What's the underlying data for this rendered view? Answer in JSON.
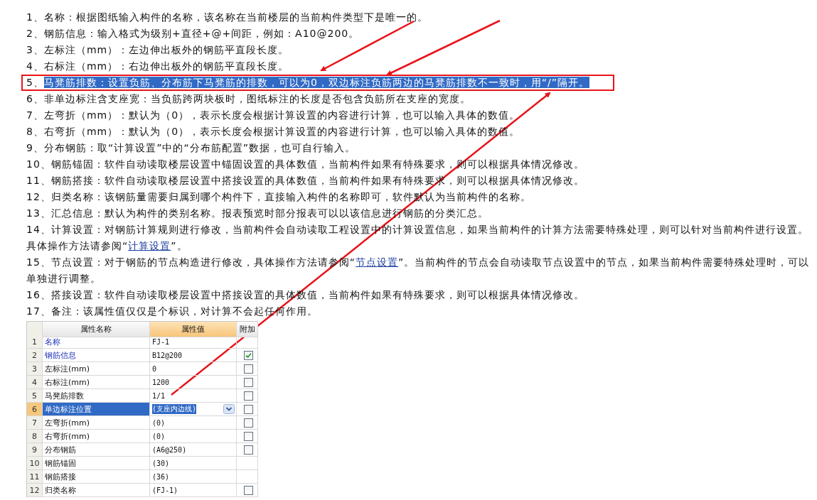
{
  "items": [
    {
      "number": "1、",
      "parts": [
        {
          "text": "名称：根据图纸输入构件的名称，该名称在当前楼层的当前构件类型下是唯一的。"
        }
      ],
      "highlighted": false
    },
    {
      "number": "2、",
      "parts": [
        {
          "text": "钢筋信息：输入格式为级别+直径+@+间距，例如：A10@200。"
        }
      ],
      "highlighted": false
    },
    {
      "number": "3、",
      "parts": [
        {
          "text": "左标注（mm）：左边伸出板外的钢筋平直段长度。"
        }
      ],
      "highlighted": false
    },
    {
      "number": "4、",
      "parts": [
        {
          "text": "右标注（mm）：右边伸出板外的钢筋平直段长度。"
        }
      ],
      "highlighted": false
    },
    {
      "number": "5、",
      "parts": [
        {
          "text": "马凳筋排数：设置负筋、分布筋下马凳筋的排数，可以为0，双边标注负筋两边的马凳筋排数不一致时，用“/”隔开。"
        }
      ],
      "highlighted": true
    },
    {
      "number": "6、",
      "parts": [
        {
          "text": "非单边标注含支座宽：当负筋跨两块板时，图纸标注的长度是否包含负筋所在支座的宽度。"
        }
      ],
      "highlighted": false
    },
    {
      "number": "7、",
      "parts": [
        {
          "text": "左弯折（mm）：默认为（0），表示长度会根据计算设置的内容进行计算，也可以输入具体的数值。"
        }
      ],
      "highlighted": false
    },
    {
      "number": "8、",
      "parts": [
        {
          "text": "右弯折（mm）：默认为（0），表示长度会根据计算设置的内容进行计算，也可以输入具体的数值。"
        }
      ],
      "highlighted": false
    },
    {
      "number": "9、",
      "parts": [
        {
          "text": "分布钢筋：取“计算设置”中的“分布筋配置”数据，也可自行输入。"
        }
      ],
      "highlighted": false
    },
    {
      "number": "10、",
      "parts": [
        {
          "text": "钢筋锚固：软件自动读取楼层设置中锚固设置的具体数值，当前构件如果有特殊要求，则可以根据具体情况修改。"
        }
      ],
      "highlighted": false
    },
    {
      "number": "11、",
      "parts": [
        {
          "text": "钢筋搭接：软件自动读取楼层设置中搭接设置的具体数值，当前构件如果有特殊要求，则可以根据具体情况修改。"
        }
      ],
      "highlighted": false
    },
    {
      "number": "12、",
      "parts": [
        {
          "text": "归类名称：该钢筋量需要归属到哪个构件下，直接输入构件的名称即可，软件默认为当前构件的名称。"
        }
      ],
      "highlighted": false
    },
    {
      "number": "13、",
      "parts": [
        {
          "text": "汇总信息：默认为构件的类别名称。报表预览时部分报表可以以该信息进行钢筋的分类汇总。"
        }
      ],
      "highlighted": false
    },
    {
      "number": "14、",
      "parts": [
        {
          "text": "计算设置：对钢筋计算规则进行修改，当前构件会自动读取工程设置中的计算设置信息，如果当前构件的计算方法需要特殊处理，则可以针对当前构件进行设置。具体操作方法请参阅“"
        },
        {
          "text": "计算设置",
          "link": true
        },
        {
          "text": "”。"
        }
      ],
      "highlighted": false
    },
    {
      "number": "15、",
      "parts": [
        {
          "text": "节点设置：对于钢筋的节点构造进行修改，具体操作方法请参阅“"
        },
        {
          "text": "节点设置",
          "link": true
        },
        {
          "text": "”。当前构件的节点会自动读取节点设置中的节点，如果当前构件需要特殊处理时，可以单独进行调整。"
        }
      ],
      "highlighted": false
    },
    {
      "number": "16、",
      "parts": [
        {
          "text": "搭接设置：软件自动读取楼层设置中搭接设置的具体数值，当前构件如果有特殊要求，则可以根据具体情况修改。"
        }
      ],
      "highlighted": false
    },
    {
      "number": "17、",
      "parts": [
        {
          "text": "备注：该属性值仅仅是个标识，对计算不会起任何作用。"
        }
      ],
      "highlighted": false
    }
  ],
  "table": {
    "columns": [
      "属性名称",
      "属性值",
      "附加"
    ],
    "rows": [
      {
        "number": "1",
        "name": "名称",
        "value": "FJ-1",
        "common": true,
        "kind": "none",
        "selected": false
      },
      {
        "number": "2",
        "name": "钢筋信息",
        "value": "B12@200",
        "common": true,
        "kind": "checkbox",
        "checked": true,
        "selected": false
      },
      {
        "number": "3",
        "name": "左标注(mm)",
        "value": "0",
        "common": false,
        "kind": "checkbox",
        "checked": false,
        "selected": false
      },
      {
        "number": "4",
        "name": "右标注(mm)",
        "value": "1200",
        "common": false,
        "kind": "checkbox",
        "checked": false,
        "selected": false
      },
      {
        "number": "5",
        "name": "马凳筋排数",
        "value": "1/1",
        "common": false,
        "kind": "checkbox",
        "checked": false,
        "selected": false
      },
      {
        "number": "6",
        "name": "单边标注位置",
        "value": "(支座内边线)",
        "common": false,
        "kind": "checkbox",
        "checked": false,
        "selected": true
      },
      {
        "number": "7",
        "name": "左弯折(mm)",
        "value": "(0)",
        "common": false,
        "kind": "checkbox",
        "checked": false,
        "selected": false
      },
      {
        "number": "8",
        "name": "右弯折(mm)",
        "value": "(0)",
        "common": false,
        "kind": "checkbox",
        "checked": false,
        "selected": false
      },
      {
        "number": "9",
        "name": "分布钢筋",
        "value": "(A6@250)",
        "common": false,
        "kind": "checkbox",
        "checked": false,
        "selected": false
      },
      {
        "number": "10",
        "name": "钢筋锚固",
        "value": "(30)",
        "common": false,
        "kind": "none",
        "selected": false
      },
      {
        "number": "11",
        "name": "钢筋搭接",
        "value": "(36)",
        "common": false,
        "kind": "none",
        "selected": false
      },
      {
        "number": "12",
        "name": "归类名称",
        "value": "(FJ-1)",
        "common": false,
        "kind": "checkbox",
        "checked": false,
        "selected": false
      }
    ]
  }
}
